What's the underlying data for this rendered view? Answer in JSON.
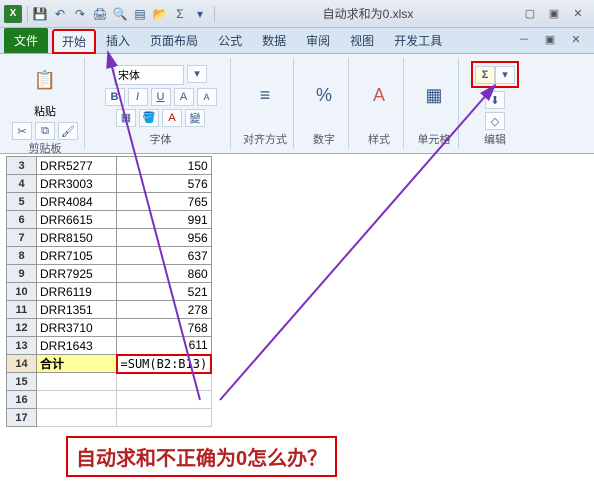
{
  "titlebar": {
    "filename": "自动求和为0.xlsx",
    "sigma": "Σ"
  },
  "tabs": {
    "file": "文件",
    "home": "开始",
    "insert": "插入",
    "layout": "页面布局",
    "formulas": "公式",
    "data": "数据",
    "review": "审阅",
    "view": "视图",
    "dev": "开发工具"
  },
  "ribbon": {
    "clipboard": "剪贴板",
    "font": "字体",
    "align": "对齐方式",
    "number": "数字",
    "styles": "样式",
    "cells": "单元格",
    "editing": "编辑",
    "paste": "粘贴",
    "fontname": "宋体",
    "bold": "B",
    "italic": "I",
    "underline": "U",
    "fontA": "A",
    "percent": "%",
    "styleA": "A",
    "sigma": "Σ"
  },
  "sheet": {
    "rows": [
      {
        "n": "3",
        "a": "DRR5277",
        "b": "150"
      },
      {
        "n": "4",
        "a": "DRR3003",
        "b": "576"
      },
      {
        "n": "5",
        "a": "DRR4084",
        "b": "765"
      },
      {
        "n": "6",
        "a": "DRR6615",
        "b": "991"
      },
      {
        "n": "7",
        "a": "DRR8150",
        "b": "956"
      },
      {
        "n": "8",
        "a": "DRR7105",
        "b": "637"
      },
      {
        "n": "9",
        "a": "DRR7925",
        "b": "860"
      },
      {
        "n": "10",
        "a": "DRR6119",
        "b": "521"
      },
      {
        "n": "11",
        "a": "DRR1351",
        "b": "278"
      },
      {
        "n": "12",
        "a": "DRR3710",
        "b": "768"
      },
      {
        "n": "13",
        "a": "DRR1643",
        "b": "611"
      }
    ],
    "sumrow": {
      "n": "14",
      "a": "合计",
      "b": "=SUM(B2:B13)"
    },
    "empty": [
      "15",
      "16",
      "17"
    ]
  },
  "annotation": "自动求和不正确为0怎么办？"
}
